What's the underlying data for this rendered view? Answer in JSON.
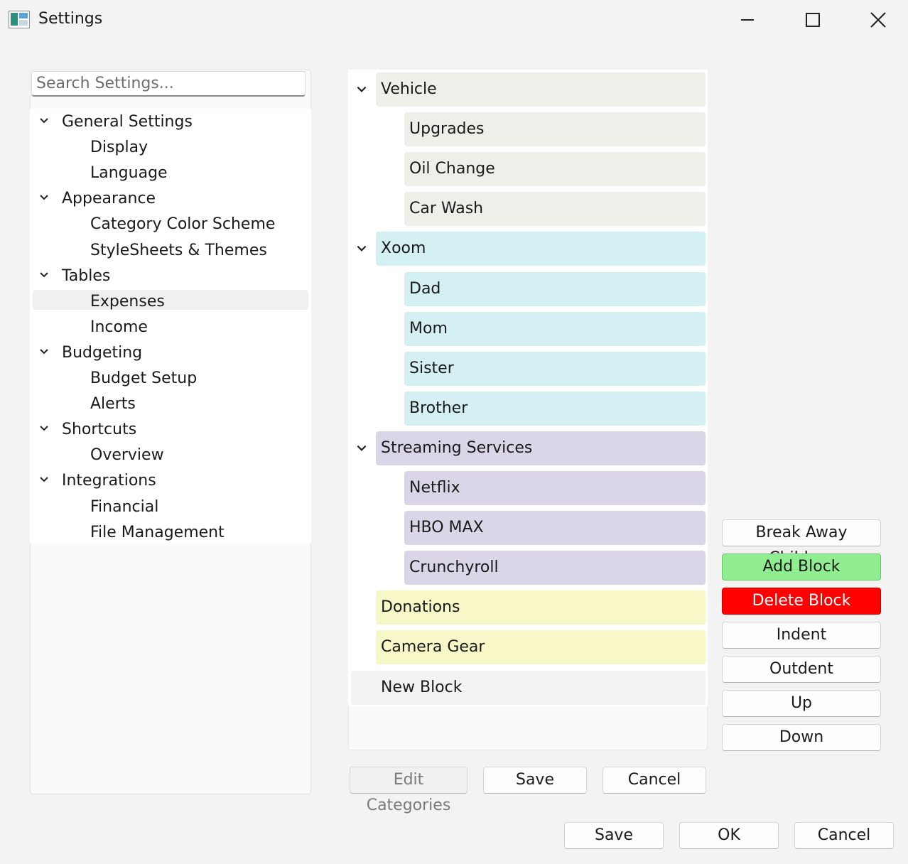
{
  "window": {
    "title": "Settings",
    "icon": "settings-app-icon",
    "controls": [
      "minimize-icon",
      "maximize-icon",
      "close-icon"
    ]
  },
  "search": {
    "placeholder": "Search Settings..."
  },
  "nav": {
    "groups": [
      {
        "label": "General Settings",
        "children": [
          "Display",
          "Language"
        ]
      },
      {
        "label": "Appearance",
        "children": [
          "Category Color Scheme",
          "StyleSheets & Themes"
        ]
      },
      {
        "label": "Tables",
        "children": [
          "Expenses",
          "Income"
        ]
      },
      {
        "label": "Budgeting",
        "children": [
          "Budget Setup",
          "Alerts"
        ]
      },
      {
        "label": "Shortcuts",
        "children": [
          "Overview"
        ]
      },
      {
        "label": "Integrations",
        "children": [
          "Financial",
          "File Management"
        ]
      }
    ],
    "selected": "Expenses"
  },
  "blocks": {
    "colors": {
      "vehicle": "#efefea",
      "xoom": "#d5f0f2",
      "streaming": "#dad6e8",
      "misc": "#f8f7c8",
      "new": "#f3f3f3"
    },
    "groups": [
      {
        "label": "Vehicle",
        "expanded": true,
        "children": [
          "Upgrades",
          "Oil Change",
          "Car Wash"
        ]
      },
      {
        "label": "Xoom",
        "expanded": true,
        "children": [
          "Dad",
          "Mom",
          "Sister",
          "Brother"
        ]
      },
      {
        "label": "Streaming Services",
        "expanded": true,
        "children": [
          "Netflix",
          "HBO MAX",
          "Crunchyroll"
        ]
      },
      {
        "label": "Donations",
        "children": []
      },
      {
        "label": "Camera Gear",
        "children": []
      },
      {
        "label": "New Block",
        "children": []
      }
    ]
  },
  "actions": {
    "break_away": "Break Away Children",
    "add": "Add Block",
    "delete": "Delete Block",
    "indent": "Indent",
    "outdent": "Outdent",
    "up": "Up",
    "down": "Down",
    "add_color": "#90ee90",
    "delete_color": "#ff0000"
  },
  "panel_buttons": {
    "edit_categories": "Edit Categories",
    "save": "Save",
    "cancel": "Cancel"
  },
  "footer": {
    "save": "Save",
    "ok": "OK",
    "cancel": "Cancel"
  }
}
